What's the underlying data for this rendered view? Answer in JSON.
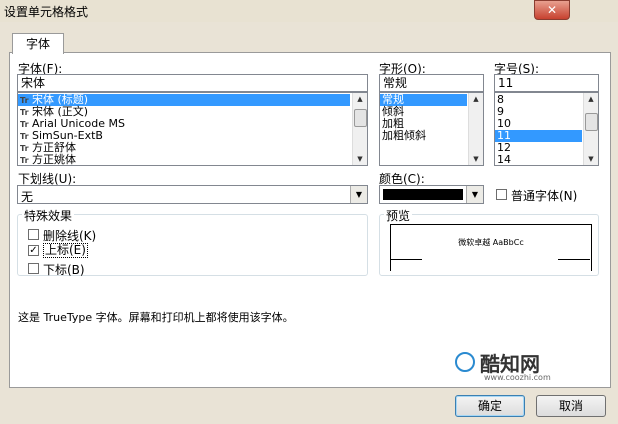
{
  "window": {
    "title": "设置单元格格式",
    "close_glyph": "✕"
  },
  "tabs": [
    {
      "label": "字体"
    }
  ],
  "font": {
    "label": "字体(F):",
    "value": "宋体",
    "items": [
      "宋体 (标题)",
      "宋体 (正文)",
      "Arial Unicode MS",
      "SimSun-ExtB",
      "方正舒体",
      "方正姚体"
    ],
    "selected_index": 0
  },
  "style": {
    "label": "字形(O):",
    "value": "常规",
    "items": [
      "常规",
      "倾斜",
      "加粗",
      "加粗倾斜"
    ],
    "selected_index": 0
  },
  "size": {
    "label": "字号(S):",
    "value": "11",
    "items": [
      "8",
      "9",
      "10",
      "11",
      "12",
      "14"
    ],
    "selected_index": 3
  },
  "underline": {
    "label": "下划线(U):",
    "value": "无"
  },
  "color": {
    "label": "颜色(C):",
    "value_hex": "#000000"
  },
  "normal_font": {
    "label": "普通字体(N)",
    "checked": false
  },
  "effects": {
    "title": "特殊效果",
    "strikethrough": {
      "label": "删除线(K)",
      "checked": false
    },
    "superscript": {
      "label": "上标(E)",
      "checked": true
    },
    "subscript": {
      "label": "下标(B)",
      "checked": false
    }
  },
  "preview": {
    "title": "预览",
    "sample": "微软卓越 AaBbCc"
  },
  "description": "这是 TrueType 字体。屏幕和打印机上都将使用该字体。",
  "buttons": {
    "ok": "确定",
    "cancel": "取消"
  },
  "watermark": {
    "name": "酷知网",
    "url": "www.coozhi.com"
  },
  "icons": {
    "tt": "Tr"
  }
}
